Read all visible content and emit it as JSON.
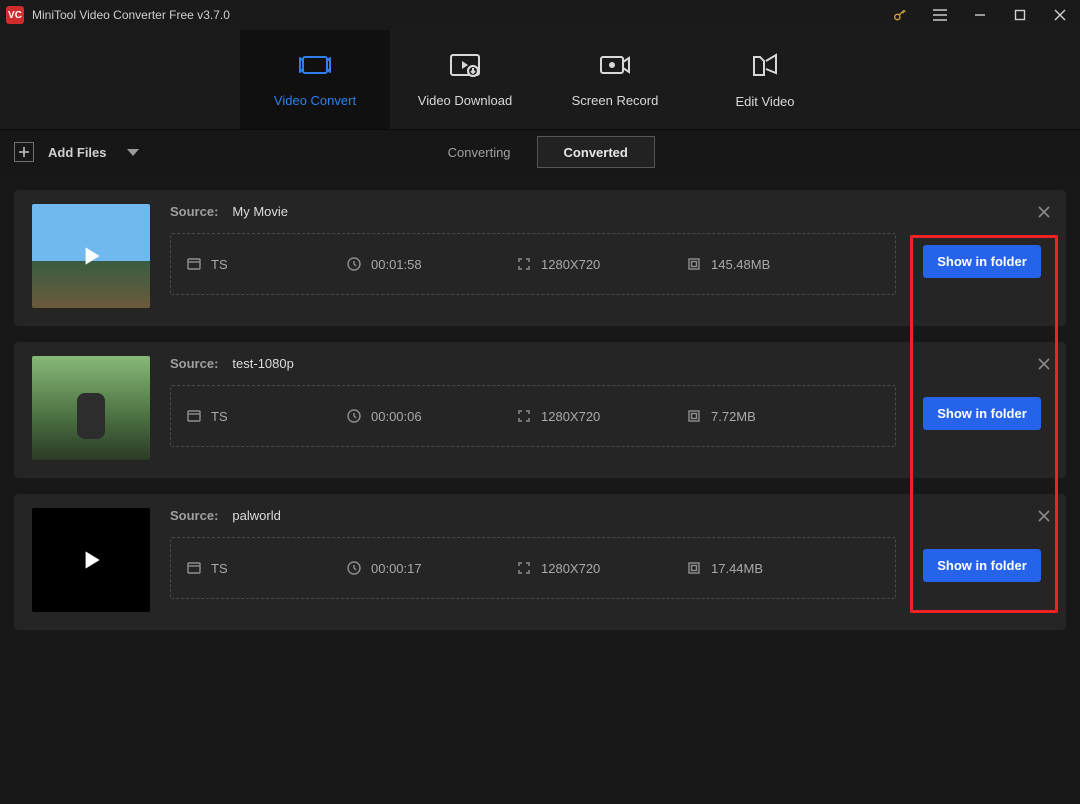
{
  "app": {
    "title": "MiniTool Video Converter Free v3.7.0"
  },
  "nav": {
    "tabs": [
      {
        "label": "Video Convert"
      },
      {
        "label": "Video Download"
      },
      {
        "label": "Screen Record"
      },
      {
        "label": "Edit Video"
      }
    ]
  },
  "toolbar": {
    "add_files_label": "Add Files",
    "seg_converting": "Converting",
    "seg_converted": "Converted"
  },
  "cards": [
    {
      "source_label": "Source:",
      "name": "My Movie",
      "format": "TS",
      "duration": "00:01:58",
      "resolution": "1280X720",
      "size": "145.48MB",
      "action": "Show in folder"
    },
    {
      "source_label": "Source:",
      "name": "test-1080p",
      "format": "TS",
      "duration": "00:00:06",
      "resolution": "1280X720",
      "size": "7.72MB",
      "action": "Show in folder"
    },
    {
      "source_label": "Source:",
      "name": "palworld",
      "format": "TS",
      "duration": "00:00:17",
      "resolution": "1280X720",
      "size": "17.44MB",
      "action": "Show in folder"
    }
  ]
}
